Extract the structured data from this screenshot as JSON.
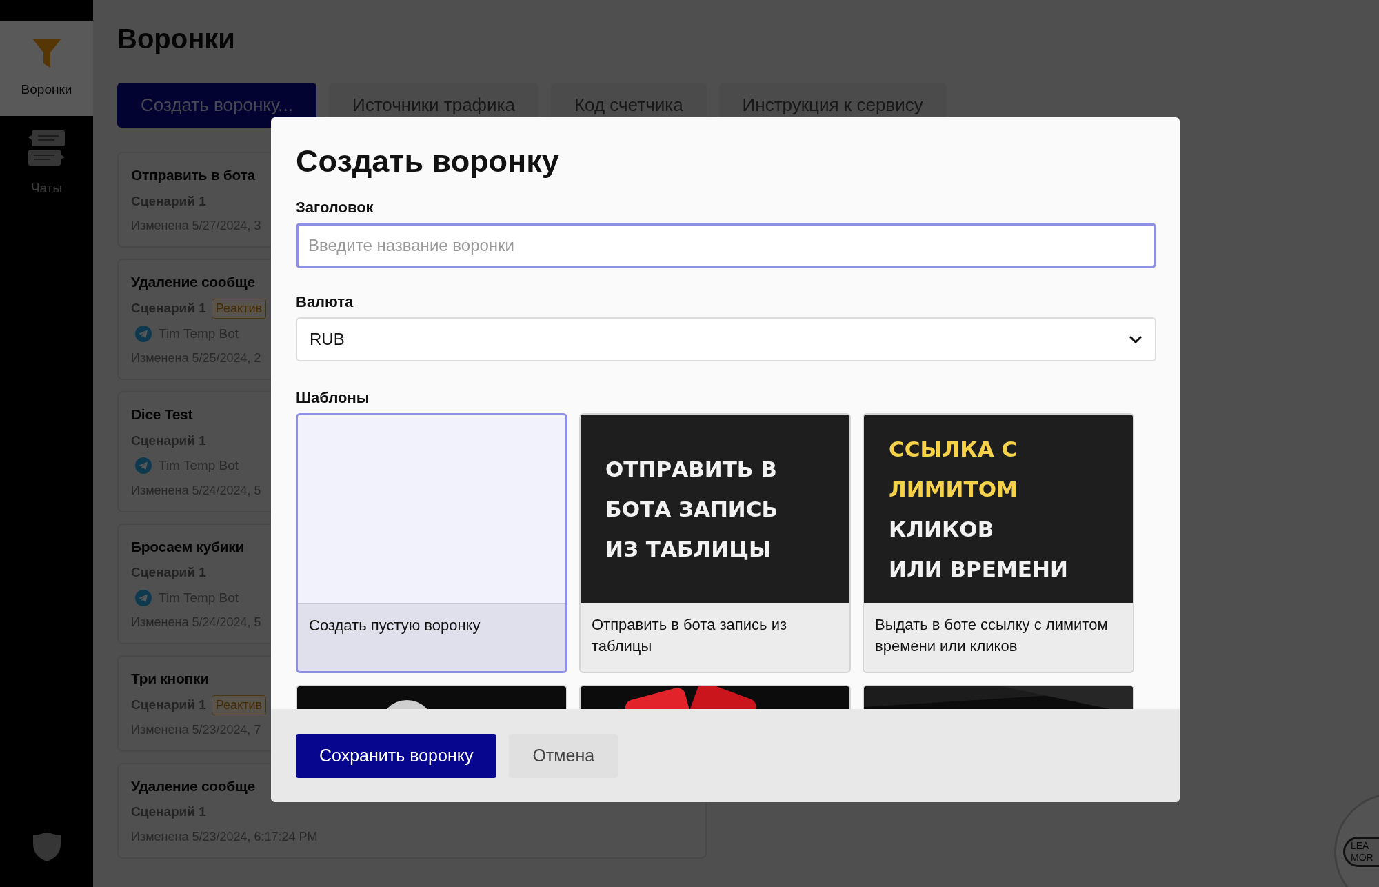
{
  "sidebar": {
    "items": [
      {
        "label": "Воронки",
        "selected": true
      },
      {
        "label": "Чаты",
        "selected": false
      }
    ]
  },
  "page": {
    "title": "Воронки",
    "actions": [
      {
        "label": "Создать воронку...",
        "primary": true
      },
      {
        "label": "Источники трафика",
        "primary": false
      },
      {
        "label": "Код счетчика",
        "primary": false
      },
      {
        "label": "Инструкция к сервису",
        "primary": false
      }
    ]
  },
  "funnels": [
    {
      "title": "Отправить в бота",
      "scenario": "Сценарий 1",
      "modified": "Изменена 5/27/2024, 3"
    },
    {
      "title": "Удаление сообще",
      "scenario": "Сценарий 1",
      "badge": "Реактив",
      "bot": "Tim Temp Bot",
      "modified": "Изменена 5/25/2024, 2"
    },
    {
      "title": "Dice Test",
      "scenario": "Сценарий 1",
      "bot": "Tim Temp Bot",
      "modified": "Изменена 5/24/2024, 5"
    },
    {
      "title": "Бросаем кубики",
      "scenario": "Сценарий 1",
      "bot": "Tim Temp Bot",
      "modified": "Изменена 5/24/2024, 5"
    },
    {
      "title": "Три кнопки",
      "scenario": "Сценарий 1",
      "badge": "Реактив",
      "modified": "Изменена 5/23/2024, 7"
    },
    {
      "title": "Удаление сообще",
      "scenario": "Сценарий 1",
      "modified": "Изменена 5/23/2024, 6:17:24 PM"
    }
  ],
  "modal": {
    "title": "Создать воронку",
    "name_field": {
      "label": "Заголовок",
      "placeholder": "Введите название воронки"
    },
    "currency_field": {
      "label": "Валюта",
      "value": "RUB"
    },
    "templates_label": "Шаблоны",
    "templates": [
      {
        "kind": "blank",
        "selected": true,
        "caption": "Создать пустую воронку"
      },
      {
        "kind": "poster",
        "selected": false,
        "caption": "Отправить в бота запись из таблицы",
        "poster_lines": [
          {
            "text": "ОТПРАВИТЬ В",
            "highlight": false
          },
          {
            "text": "БОТА ЗАПИСЬ",
            "highlight": false
          },
          {
            "text": "ИЗ ТАБЛИЦЫ",
            "highlight": false
          }
        ]
      },
      {
        "kind": "poster",
        "selected": false,
        "caption": "Выдать в боте ссылку с лимитом времени или кликов",
        "poster_lines": [
          {
            "text": "ССЫЛКА С",
            "highlight": true
          },
          {
            "text": "ЛИМИТОМ",
            "highlight": true
          },
          {
            "text": "КЛИКОВ",
            "highlight": false
          },
          {
            "text": "ИЛИ ВРЕМЕНИ",
            "highlight": false
          }
        ]
      },
      {
        "kind": "picture",
        "selected": false
      },
      {
        "kind": "picture",
        "selected": false
      },
      {
        "kind": "picture",
        "selected": false
      }
    ],
    "buttons": [
      {
        "label": "Сохранить воронку",
        "primary": true
      },
      {
        "label": "Отмена",
        "primary": false
      }
    ]
  },
  "learn_more": {
    "lines": [
      "LEA",
      "MOR"
    ]
  }
}
